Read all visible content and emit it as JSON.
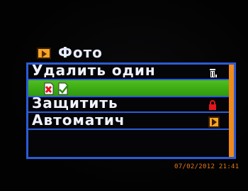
{
  "title": {
    "icon": "play-folder-icon",
    "text": "Фото"
  },
  "menu": {
    "items": [
      {
        "label": "Удалить один",
        "icon": "trash-icon"
      },
      {
        "label": "",
        "icons": [
          "delete-file-icon",
          "checkmark-file-icon"
        ],
        "selected": true
      },
      {
        "label": "Защитить",
        "icon": "lock-icon"
      },
      {
        "label": "Автоматич",
        "icon": "play-icon"
      },
      {
        "label": ""
      }
    ],
    "scrollbar_color": "#f08a18",
    "selected_color": "#3fb016",
    "border_color": "#2b5cd6"
  },
  "timestamp": "07/02/2012 21:41"
}
